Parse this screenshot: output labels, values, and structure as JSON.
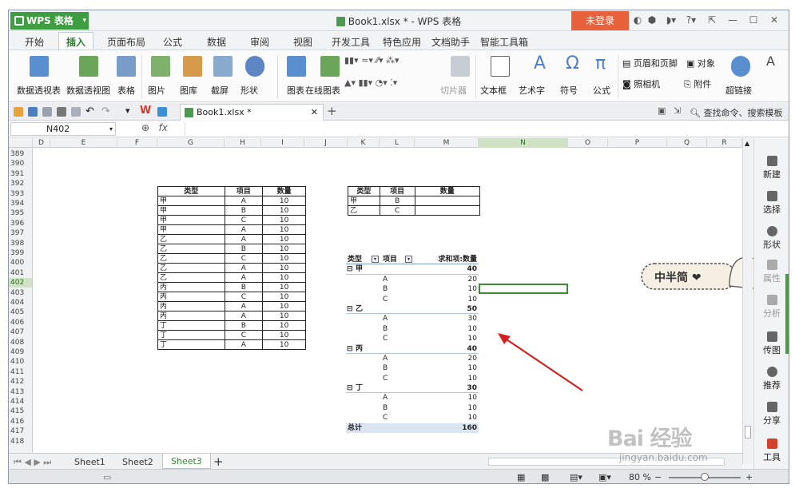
{
  "titlebar": {
    "app": "WPS 表格",
    "title": "Book1.xlsx * - WPS 表格",
    "login": "未登录"
  },
  "tabs": [
    "开始",
    "插入",
    "页面布局",
    "公式",
    "数据",
    "审阅",
    "视图",
    "开发工具",
    "特色应用",
    "文档助手",
    "智能工具箱"
  ],
  "active_tab": "插入",
  "ribbon": {
    "pivot_table": "数据透视表",
    "pivot_chart": "数据透视图",
    "table": "表格",
    "picture": "图片",
    "gallery": "图库",
    "screenshot": "截屏",
    "shape": "形状",
    "chart": "图表",
    "online_chart": "在线图表",
    "slicer": "切片器",
    "textbox": "文本框",
    "wordart": "艺术字",
    "symbol": "符号",
    "formula": "公式",
    "header_footer": "页眉和页脚",
    "object": "对象",
    "camera": "照相机",
    "attachment": "附件",
    "hyperlink": "超链接",
    "omega": "Ω",
    "pi": "π",
    "letter_a": "A",
    "letter_a2": "A"
  },
  "quickbar": {
    "file_tab": "Book1.xlsx *",
    "search": "查找命令、搜索模板"
  },
  "formula_bar": {
    "name_box": "N402",
    "fx": "fx"
  },
  "columns": [
    "D",
    "E",
    "F",
    "G",
    "H",
    "I",
    "J",
    "K",
    "L",
    "M",
    "N",
    "O",
    "P",
    "Q",
    "R"
  ],
  "rows": [
    "389",
    "390",
    "391",
    "392",
    "393",
    "394",
    "395",
    "396",
    "397",
    "398",
    "399",
    "400",
    "401",
    "402",
    "403",
    "404",
    "405",
    "406",
    "407",
    "408",
    "409",
    "410",
    "411",
    "412",
    "413",
    "414",
    "415",
    "416",
    "417",
    "418"
  ],
  "source_table": {
    "headers": [
      "类型",
      "项目",
      "数量"
    ],
    "rows": [
      [
        "甲",
        "A",
        "10"
      ],
      [
        "甲",
        "B",
        "10"
      ],
      [
        "甲",
        "C",
        "10"
      ],
      [
        "甲",
        "A",
        "10"
      ],
      [
        "乙",
        "A",
        "10"
      ],
      [
        "乙",
        "B",
        "10"
      ],
      [
        "乙",
        "C",
        "10"
      ],
      [
        "乙",
        "A",
        "10"
      ],
      [
        "乙",
        "A",
        "10"
      ],
      [
        "丙",
        "B",
        "10"
      ],
      [
        "丙",
        "C",
        "10"
      ],
      [
        "丙",
        "A",
        "10"
      ],
      [
        "丙",
        "A",
        "10"
      ],
      [
        "丁",
        "B",
        "10"
      ],
      [
        "丁",
        "C",
        "10"
      ],
      [
        "丁",
        "A",
        "10"
      ]
    ]
  },
  "criteria_table": {
    "headers": [
      "类型",
      "项目",
      "数量"
    ],
    "rows": [
      [
        "甲",
        "B",
        ""
      ],
      [
        "乙",
        "C",
        ""
      ]
    ]
  },
  "pivot": {
    "header": [
      "类型",
      "项目",
      "求和项:数量"
    ],
    "groups": [
      {
        "name": "甲",
        "total": "40",
        "items": [
          [
            "A",
            "20"
          ],
          [
            "B",
            "10"
          ],
          [
            "C",
            "10"
          ]
        ]
      },
      {
        "name": "乙",
        "total": "50",
        "items": [
          [
            "A",
            "30"
          ],
          [
            "B",
            "10"
          ],
          [
            "C",
            "10"
          ]
        ]
      },
      {
        "name": "丙",
        "total": "40",
        "items": [
          [
            "A",
            "20"
          ],
          [
            "B",
            "10"
          ],
          [
            "C",
            "10"
          ]
        ]
      },
      {
        "name": "丁",
        "total": "30",
        "items": [
          [
            "A",
            "10"
          ],
          [
            "B",
            "10"
          ],
          [
            "C",
            "10"
          ]
        ]
      }
    ],
    "grand_label": "总计",
    "grand_total": "160"
  },
  "right_panel": [
    "新建",
    "选择",
    "形状",
    "属性",
    "分析",
    "传图",
    "推荐",
    "分享",
    "工具"
  ],
  "sheets": [
    "Sheet1",
    "Sheet2",
    "Sheet3"
  ],
  "active_sheet": "Sheet3",
  "status": {
    "zoom": "80 %"
  },
  "sticker_text": "中半简 ❤",
  "watermark": {
    "brand": "Bai 经验",
    "url": "jingyan.baidu.com"
  },
  "colors": {
    "brand_green": "#3e9c41",
    "login_orange": "#e8613a",
    "pivot_total": "#dbe5f1"
  }
}
